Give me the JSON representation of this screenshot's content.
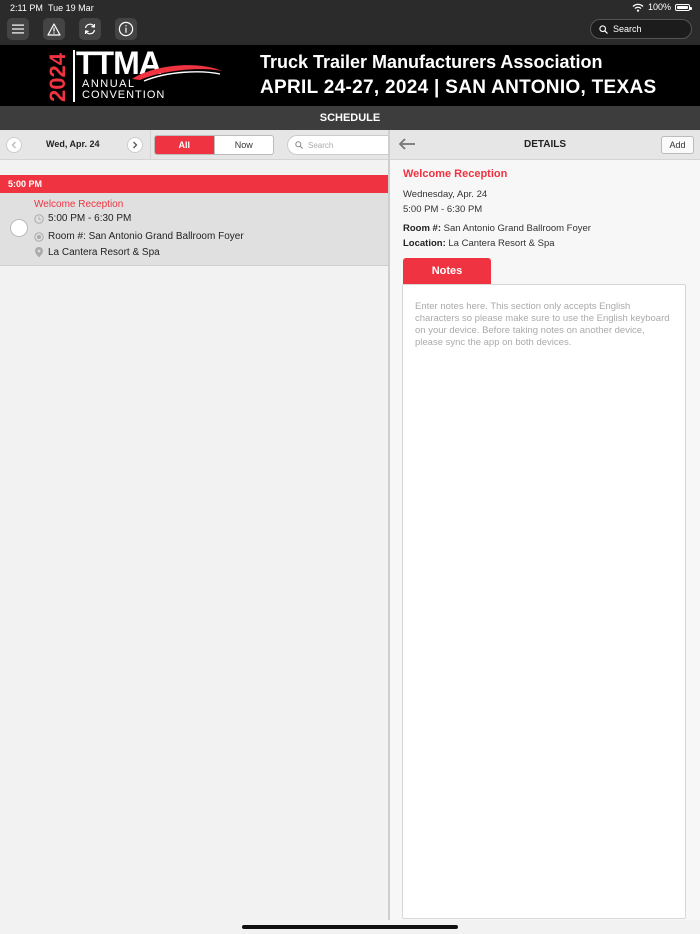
{
  "status": {
    "time": "2:11 PM",
    "date": "Tue 19 Mar",
    "battery": "100%"
  },
  "toolbar": {
    "icons": [
      "menu-icon",
      "alert-icon",
      "sync-icon",
      "info-icon"
    ],
    "search_placeholder": "Search"
  },
  "banner": {
    "year": "2024",
    "logo": "TTMA",
    "annual": "ANNUAL",
    "convention": "CONVENTION",
    "association": "Truck Trailer Manufacturers Association",
    "dates": "APRIL 24-27, 2024 | SAN ANTONIO, TEXAS"
  },
  "header": {
    "title": "SCHEDULE"
  },
  "schedule": {
    "day": "Wed, Apr. 24",
    "filters": {
      "all": "All",
      "now": "Now"
    },
    "search_placeholder": "Search",
    "time_header": "5:00 PM",
    "event": {
      "title": "Welcome Reception",
      "time": "5:00 PM - 6:30 PM",
      "room": "Room #: San Antonio Grand Ballroom Foyer",
      "location": "La Cantera Resort & Spa"
    }
  },
  "details": {
    "header": "DETAILS",
    "add_label": "Add",
    "title": "Welcome Reception",
    "date": "Wednesday, Apr. 24",
    "time": "5:00 PM - 6:30 PM",
    "room_label": "Room #:",
    "room": "San Antonio Grand Ballroom Foyer",
    "location_label": "Location:",
    "location": "La Cantera Resort & Spa",
    "notes_tab": "Notes",
    "notes_placeholder": "Enter notes here. This section only accepts English characters so please make sure to use the English keyboard on your device. Before taking notes on another device, please sync the app on both devices."
  },
  "colors": {
    "accent": "#ef3340",
    "dark": "#2b2b2b",
    "banner": "#000000"
  }
}
